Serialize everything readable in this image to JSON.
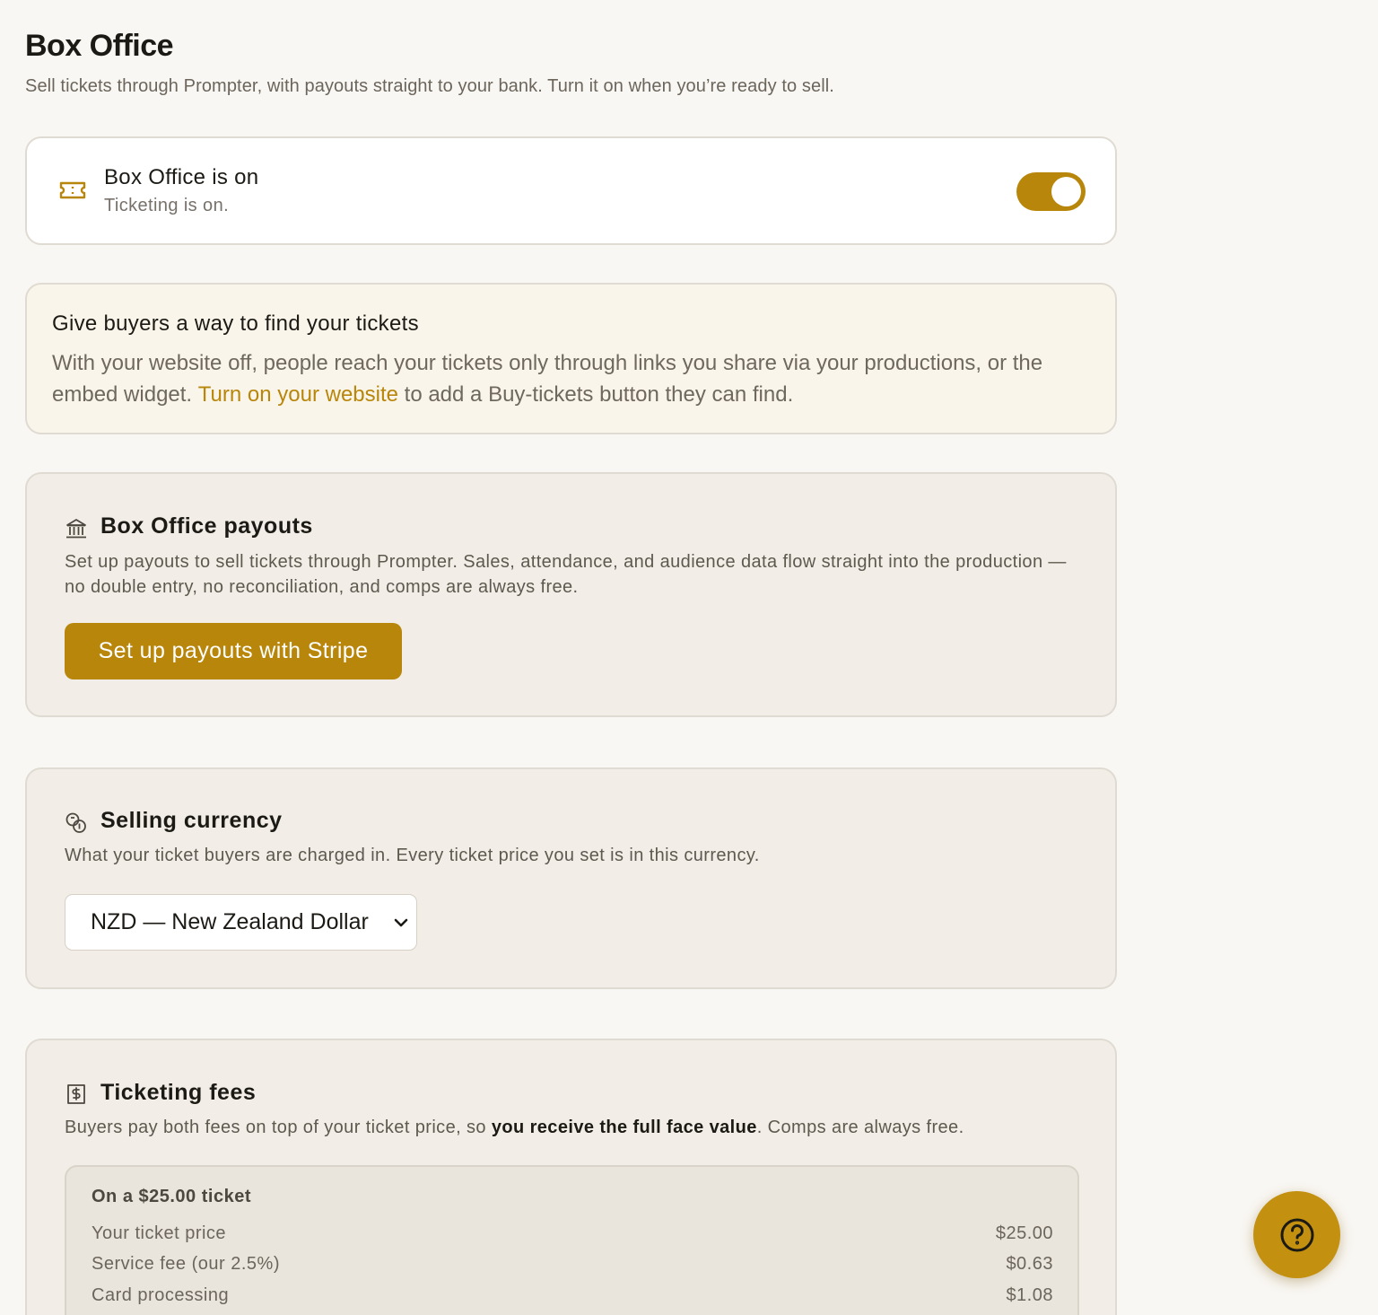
{
  "header": {
    "title": "Box Office",
    "subtitle": "Sell tickets through Prompter, with payouts straight to your bank. Turn it on when you’re ready to sell."
  },
  "status": {
    "icon": "ticket-icon",
    "title": "Box Office is on",
    "subtitle": "Ticketing is on.",
    "toggle_on": true
  },
  "info": {
    "title": "Give buyers a way to find your tickets",
    "body_before": "With your website off, people reach your tickets only through links you share via your productions, or the embed widget. ",
    "link": "Turn on your website",
    "body_after": " to add a Buy-tickets button they can find."
  },
  "payouts": {
    "icon": "bank-icon",
    "title": "Box Office payouts",
    "description": "Set up payouts to sell tickets through Prompter. Sales, attendance, and audience data flow straight into the production — no double entry, no reconciliation, and comps are always free.",
    "button_label": "Set up payouts with Stripe"
  },
  "currency": {
    "icon": "coins-icon",
    "title": "Selling currency",
    "description": "What your ticket buyers are charged in. Every ticket price you set is in this currency.",
    "selected": "NZD — New Zealand Dollar"
  },
  "fees": {
    "icon": "receipt-dollar-icon",
    "title": "Ticketing fees",
    "desc_before": "Buyers pay both fees on top of your ticket price, so ",
    "desc_strong": "you receive the full face value",
    "desc_after": ". Comps are always free.",
    "example_heading": "On a $25.00 ticket",
    "rows": [
      {
        "label": "Your ticket price",
        "value": "$25.00"
      },
      {
        "label": "Service fee (our 2.5%)",
        "value": "$0.63"
      },
      {
        "label": "Card processing",
        "value": "$1.08"
      }
    ]
  },
  "help": {
    "icon": "help-question-icon"
  },
  "colors": {
    "accent": "#b8860b",
    "background": "#f9f7f3",
    "info_background": "#faf5ea",
    "section_background": "#f2eee7"
  }
}
